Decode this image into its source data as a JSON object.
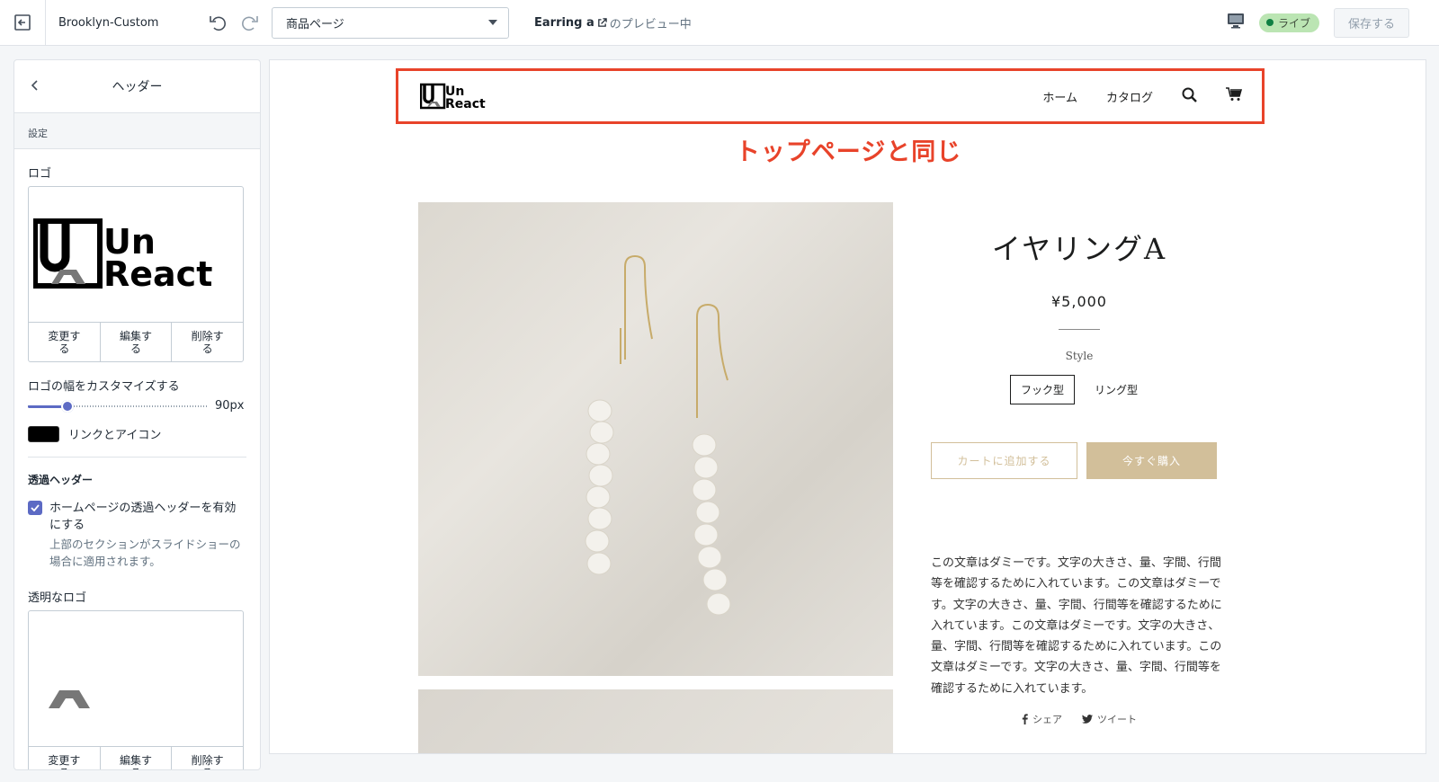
{
  "topbar": {
    "theme_name": "Brooklyn-Custom",
    "page_select": "商品ページ",
    "preview_product": "Earring a",
    "preview_suffix": "のプレビュー中",
    "live_label": "ライブ",
    "save_label": "保存する",
    "icons": [
      "exit-icon",
      "undo-icon",
      "redo-icon",
      "external-link-icon",
      "desktop-icon"
    ]
  },
  "sidebar": {
    "title": "ヘッダー",
    "section_label": "設定",
    "logo_label": "ロゴ",
    "logo_actions": [
      "変更する",
      "編集する",
      "削除する"
    ],
    "logo_width_label": "ロゴの幅をカスタマイズする",
    "logo_width_value": "90px",
    "logo_width_fraction": 0.2,
    "color_label": "リンクとアイコン",
    "color_value": "#000000",
    "transparent_heading": "透過ヘッダー",
    "transparent_checkbox_label": "ホームページの透過ヘッダーを有効にする",
    "transparent_checked": true,
    "transparent_help": "上部のセクションがスライドショーの場合に適用されます。",
    "transparent_logo_label": "透明なロゴ",
    "transparent_logo_actions": [
      "変更する",
      "編集する",
      "削除する"
    ]
  },
  "preview": {
    "logo_text_top": "Un",
    "logo_text_bottom": "React",
    "nav": [
      "ホーム",
      "カタログ"
    ],
    "annotation": "トップページと同じ",
    "product": {
      "title": "イヤリングA",
      "price": "¥5,000",
      "style_label": "Style",
      "variants": [
        "フック型",
        "リング型"
      ],
      "selected_variant": "フック型",
      "add_to_cart": "カートに追加する",
      "buy_now": "今すぐ購入",
      "description": "この文章はダミーです。文字の大きさ、量、字間、行間等を確認するために入れています。この文章はダミーです。文字の大きさ、量、字間、行間等を確認するために入れています。この文章はダミーです。文字の大きさ、量、字間、行間等を確認するために入れています。この文章はダミーです。文字の大きさ、量、字間、行間等を確認するために入れています。",
      "share": "シェア",
      "tweet": "ツイート"
    }
  },
  "colors": {
    "accent": "#5c6ac4",
    "live_badge": "#bbe5b3",
    "annotation": "#e8432a",
    "button_gold": "#d2bf9a"
  }
}
